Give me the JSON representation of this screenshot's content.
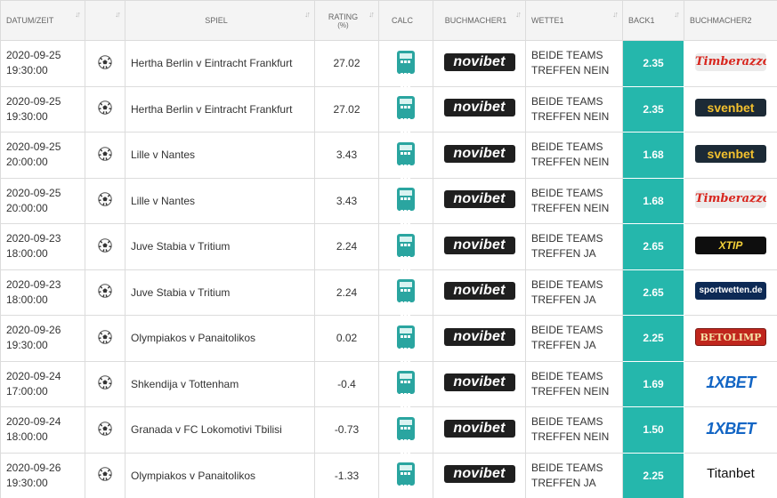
{
  "headers": {
    "datum": "DATUM/ZEIT",
    "sport": "",
    "spiel": "SPIEL",
    "rating": "RATING",
    "rating_unit": "(%)",
    "calc": "CALC",
    "buchmacher1": "BUCHMACHER1",
    "wette": "WETTE1",
    "back": "BACK1",
    "buchmacher2": "BUCHMACHER2"
  },
  "sort_glyph": "↓↑",
  "brand": {
    "back_color": "#25b7ac",
    "calc_color": "#2aa5a0"
  },
  "bookmakers": {
    "novibet": "novibet",
    "timberazzo": "Timberazzo.com",
    "svenbet": "svenbet",
    "xtip": "XTIP",
    "sportwetten": "sportwetten.de",
    "betolimp": "BETOLIMP",
    "onexbet": "1XBET",
    "titanbet": "Titanbet"
  },
  "rows": [
    {
      "date": "2020-09-25",
      "time": "19:30:00",
      "match": "Hertha Berlin v Eintracht Frankfurt",
      "rating": "27.02",
      "bm1": "novibet",
      "bet_line1": "BEIDE TEAMS",
      "bet_line2": "TREFFEN NEIN",
      "back": "2.35",
      "bm2": "Timberazzo.com",
      "bm2_key": "timberazzo"
    },
    {
      "date": "2020-09-25",
      "time": "19:30:00",
      "match": "Hertha Berlin v Eintracht Frankfurt",
      "rating": "27.02",
      "bm1": "novibet",
      "bet_line1": "BEIDE TEAMS",
      "bet_line2": "TREFFEN NEIN",
      "back": "2.35",
      "bm2": "svenbet",
      "bm2_key": "svenbet"
    },
    {
      "date": "2020-09-25",
      "time": "20:00:00",
      "match": "Lille v Nantes",
      "rating": "3.43",
      "bm1": "novibet",
      "bet_line1": "BEIDE TEAMS",
      "bet_line2": "TREFFEN NEIN",
      "back": "1.68",
      "bm2": "svenbet",
      "bm2_key": "svenbet"
    },
    {
      "date": "2020-09-25",
      "time": "20:00:00",
      "match": "Lille v Nantes",
      "rating": "3.43",
      "bm1": "novibet",
      "bet_line1": "BEIDE TEAMS",
      "bet_line2": "TREFFEN NEIN",
      "back": "1.68",
      "bm2": "Timberazzo.com",
      "bm2_key": "timberazzo"
    },
    {
      "date": "2020-09-23",
      "time": "18:00:00",
      "match": "Juve Stabia v Tritium",
      "rating": "2.24",
      "bm1": "novibet",
      "bet_line1": "BEIDE TEAMS",
      "bet_line2": "TREFFEN JA",
      "back": "2.65",
      "bm2": "XTIP",
      "bm2_key": "xtip"
    },
    {
      "date": "2020-09-23",
      "time": "18:00:00",
      "match": "Juve Stabia v Tritium",
      "rating": "2.24",
      "bm1": "novibet",
      "bet_line1": "BEIDE TEAMS",
      "bet_line2": "TREFFEN JA",
      "back": "2.65",
      "bm2": "sportwetten.de",
      "bm2_key": "sportwetten"
    },
    {
      "date": "2020-09-26",
      "time": "19:30:00",
      "match": "Olympiakos v Panaitolikos",
      "rating": "0.02",
      "bm1": "novibet",
      "bet_line1": "BEIDE TEAMS",
      "bet_line2": "TREFFEN JA",
      "back": "2.25",
      "bm2": "BETOLIMP",
      "bm2_key": "betolimp"
    },
    {
      "date": "2020-09-24",
      "time": "17:00:00",
      "match": "Shkendija v Tottenham",
      "rating": "-0.4",
      "bm1": "novibet",
      "bet_line1": "BEIDE TEAMS",
      "bet_line2": "TREFFEN NEIN",
      "back": "1.69",
      "bm2": "1XBET",
      "bm2_key": "onexbet"
    },
    {
      "date": "2020-09-24",
      "time": "18:00:00",
      "match": "Granada v FC Lokomotivi Tbilisi",
      "rating": "-0.73",
      "bm1": "novibet",
      "bet_line1": "BEIDE TEAMS",
      "bet_line2": "TREFFEN NEIN",
      "back": "1.50",
      "bm2": "1XBET",
      "bm2_key": "onexbet"
    },
    {
      "date": "2020-09-26",
      "time": "19:30:00",
      "match": "Olympiakos v Panaitolikos",
      "rating": "-1.33",
      "bm1": "novibet",
      "bet_line1": "BEIDE TEAMS",
      "bet_line2": "TREFFEN JA",
      "back": "2.25",
      "bm2": "Titanbet",
      "bm2_key": "titanbet"
    }
  ]
}
